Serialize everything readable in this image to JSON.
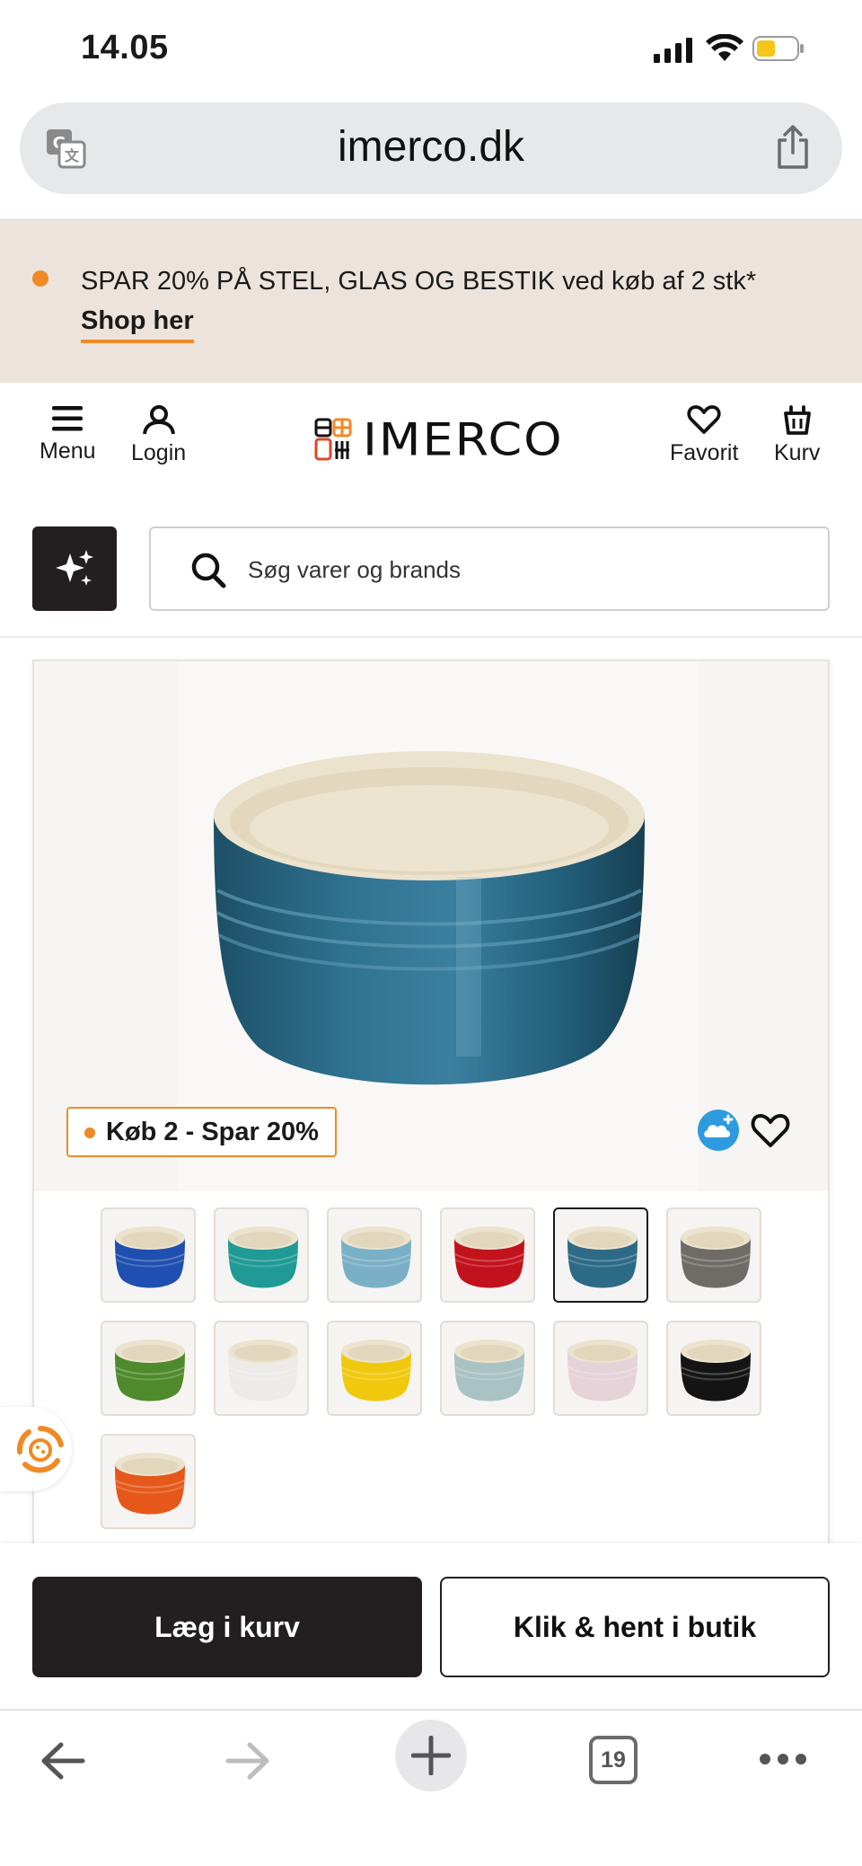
{
  "status_bar": {
    "time": "14.05",
    "icons": [
      "signal-icon",
      "wifi-icon",
      "battery-icon"
    ],
    "battery_color": "#f5c518"
  },
  "browser": {
    "domain": "imerco.dk",
    "icons": [
      "translate-icon",
      "share-icon"
    ],
    "tab_count": "19",
    "toolbar_icons": [
      "back-icon",
      "forward-icon",
      "new-tab-icon",
      "tabs-icon",
      "more-icon"
    ]
  },
  "promo": {
    "text": "SPAR 20% PÅ STEL, GLAS OG BESTIK ved køb af 2 stk*",
    "link_label": "Shop her",
    "accent_color": "#f08a24",
    "background_color": "#ece3dc"
  },
  "header": {
    "menu_label": "Menu",
    "login_label": "Login",
    "logo_text": "IMERCO",
    "favorite_label": "Favorit",
    "cart_label": "Kurv"
  },
  "search": {
    "placeholder": "Søg varer og brands",
    "value": ""
  },
  "product": {
    "badge": "Køb 2 - Spar 20%",
    "main_color": "#2d6a86",
    "selected_index": 4,
    "color_variants": [
      {
        "name": "blue",
        "color": "#1f4fb0"
      },
      {
        "name": "teal",
        "color": "#1f9a94"
      },
      {
        "name": "light-blue",
        "color": "#79b0c6"
      },
      {
        "name": "red",
        "color": "#c2121c"
      },
      {
        "name": "deep-teal",
        "color": "#2d6a86"
      },
      {
        "name": "grey",
        "color": "#6f6c68"
      },
      {
        "name": "green",
        "color": "#4f8a2d"
      },
      {
        "name": "white",
        "color": "#ecebe7"
      },
      {
        "name": "yellow",
        "color": "#f0c90f"
      },
      {
        "name": "sage",
        "color": "#a9c2c3"
      },
      {
        "name": "pink",
        "color": "#e5d3d9"
      },
      {
        "name": "black",
        "color": "#141414"
      },
      {
        "name": "orange",
        "color": "#e5581a"
      }
    ]
  },
  "actions": {
    "add_to_cart": "Læg i kurv",
    "click_collect": "Klik & hent i butik"
  }
}
